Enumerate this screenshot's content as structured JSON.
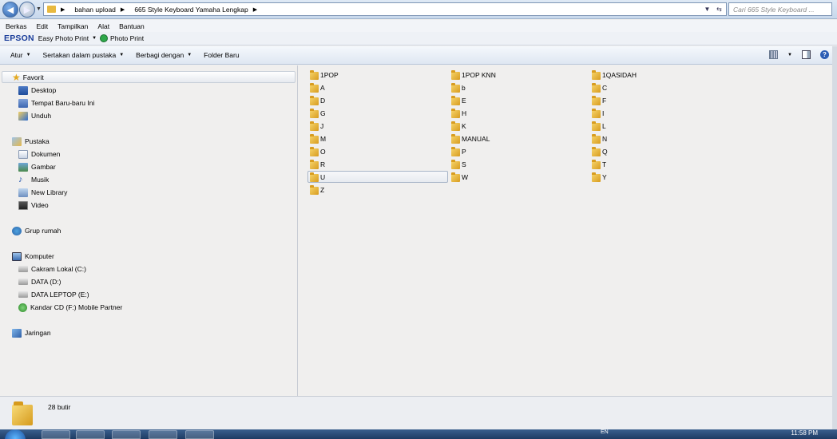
{
  "address": {
    "breadcrumbs": [
      "bahan upload",
      "665 Style Keyboard Yamaha Lengkap"
    ],
    "search_placeholder": "Cari 665 Style Keyboard ..."
  },
  "menu": [
    "Berkas",
    "Edit",
    "Tampilkan",
    "Alat",
    "Bantuan"
  ],
  "epson": {
    "brand": "EPSON",
    "easy_photo_print": "Easy Photo Print",
    "photo_print": "Photo Print"
  },
  "toolbar": {
    "organize": "Atur",
    "include_library": "Sertakan dalam pustaka",
    "share_with": "Berbagi dengan",
    "new_folder": "Folder Baru"
  },
  "nav": {
    "favorites": "Favorit",
    "desktop": "Desktop",
    "recent": "Tempat Baru-baru Ini",
    "downloads": "Unduh",
    "libraries": "Pustaka",
    "documents": "Dokumen",
    "pictures": "Gambar",
    "music": "Musik",
    "new_library": "New Library",
    "videos": "Video",
    "homegroup": "Grup rumah",
    "computer": "Komputer",
    "drive_c": "Cakram Lokal (C:)",
    "drive_d": "DATA (D:)",
    "drive_e": "DATA LEPTOP (E:)",
    "drive_f": "Kandar CD (F:)  Mobile Partner",
    "network": "Jaringan"
  },
  "folders": {
    "col1": [
      "1POP",
      "A",
      "D",
      "G",
      "J",
      "M",
      "O",
      "R",
      "U",
      "Z"
    ],
    "col2": [
      "1POP KNN",
      "b",
      "E",
      "H",
      "K",
      "MANUAL",
      "P",
      "S",
      "W"
    ],
    "col3": [
      "1QASIDAH",
      "C",
      "F",
      "I",
      "L",
      "N",
      "Q",
      "T",
      "Y"
    ]
  },
  "status": {
    "item_count": "28 butir"
  },
  "taskbar": {
    "clock": "11:58 PM",
    "lang": "EN"
  }
}
